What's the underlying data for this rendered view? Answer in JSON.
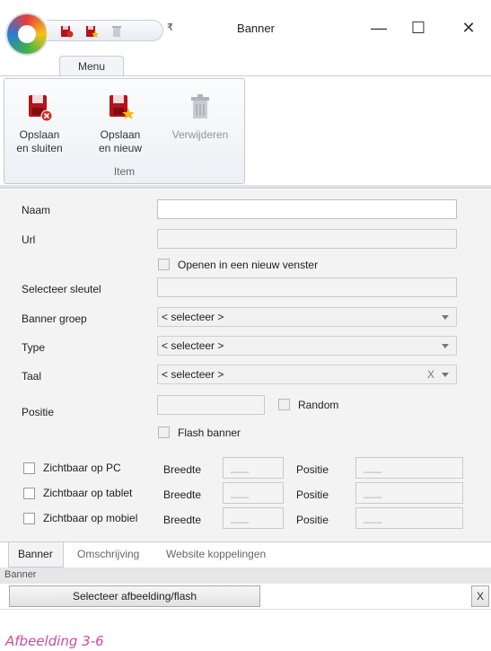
{
  "window": {
    "title": "Banner",
    "minimize": "—",
    "maximize": "☐",
    "close": "✕",
    "qat_more": "₹"
  },
  "ribbon": {
    "tab": "Menu",
    "group_label": "Item",
    "buttons": [
      {
        "line1": "Opslaan",
        "line2": "en sluiten",
        "icon": "save-close-icon",
        "enabled": true
      },
      {
        "line1": "Opslaan",
        "line2": "en nieuw",
        "icon": "save-new-icon",
        "enabled": true
      },
      {
        "line1": "Verwijderen",
        "line2": "",
        "icon": "trash-icon",
        "enabled": false
      }
    ]
  },
  "form": {
    "naam_label": "Naam",
    "naam_value": "",
    "url_label": "Url",
    "url_value": "",
    "new_window_label": "Openen in een nieuw venster",
    "key_label": "Selecteer sleutel",
    "group_label": "Banner groep",
    "group_value": "< selecteer >",
    "type_label": "Type",
    "type_value": "< selecteer >",
    "lang_label": "Taal",
    "lang_value": "< selecteer >",
    "lang_clear": "X",
    "pos_label": "Positie",
    "random_label": "Random",
    "flash_label": "Flash banner",
    "visibility": [
      {
        "label": "Zichtbaar op PC",
        "width_label": "Breedte",
        "width_value": "___",
        "pos_label": "Positie",
        "pos_value": "___"
      },
      {
        "label": "Zichtbaar op tablet",
        "width_label": "Breedte",
        "width_value": "___",
        "pos_label": "Positie",
        "pos_value": "___"
      },
      {
        "label": "Zichtbaar op mobiel",
        "width_label": "Breedte",
        "width_value": "___",
        "pos_label": "Positie",
        "pos_value": "___"
      }
    ]
  },
  "bottom": {
    "tabs": [
      "Banner",
      "Omschrijving",
      "Website koppelingen"
    ],
    "panel_caption": "Banner",
    "select_button": "Selecteer afbeelding/flash",
    "clear_button": "X"
  },
  "caption": "Afbeelding 3-6",
  "colors": {
    "accent_red": "#b5121b",
    "caption": "#d04aa0"
  }
}
